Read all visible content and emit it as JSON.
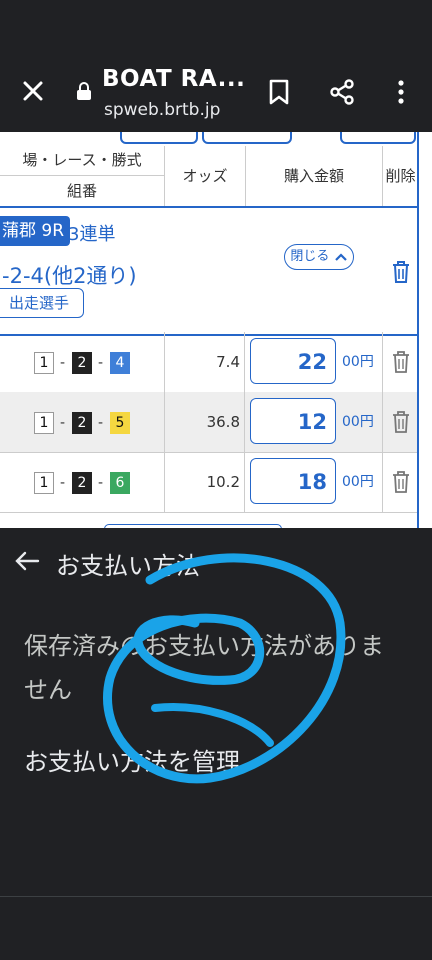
{
  "browser": {
    "title": "BOAT RA...",
    "url": "spweb.brtb.jp"
  },
  "table_header": {
    "col1_top": "場・レース・勝式",
    "col1_bottom": "組番",
    "col2": "オッズ",
    "col3": "購入金額",
    "col4": "削除"
  },
  "bet": {
    "venue": "蒲郡 9R",
    "type": "3連単",
    "combination": "-2-4(他2通り)",
    "runners_button": "出走選手",
    "close_button": "閉じる"
  },
  "rows": [
    {
      "b1": "1",
      "b2": "2",
      "b3": "4",
      "odds": "7.4",
      "amount": "22",
      "unit": "00円"
    },
    {
      "b1": "1",
      "b2": "2",
      "b3": "5",
      "odds": "36.8",
      "amount": "12",
      "unit": "00円"
    },
    {
      "b1": "1",
      "b2": "2",
      "b3": "6",
      "odds": "10.2",
      "amount": "18",
      "unit": "00円"
    }
  ],
  "sheet": {
    "title": "お支払い方法",
    "message": "保存済みのお支払い方法がありません",
    "manage": "お支払い方法を管理"
  },
  "colors": {
    "accent": "#2566c8",
    "dark_bg": "#202124",
    "scribble": "#1aa3e8"
  }
}
